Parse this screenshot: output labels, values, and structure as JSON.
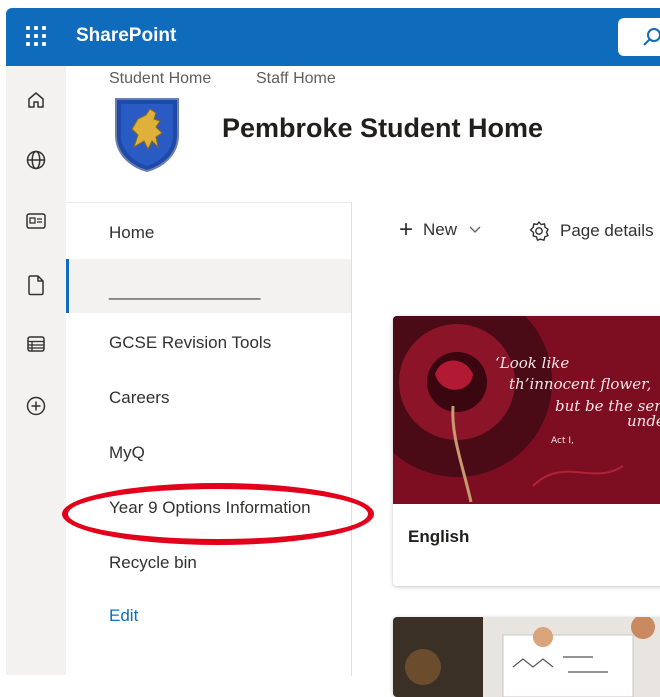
{
  "suite": {
    "app_name": "SharePoint",
    "waffle_icon": "waffle-icon",
    "search_icon": "search-icon",
    "brand_color": "#0f6cbd"
  },
  "rail": {
    "icons": [
      "home-icon",
      "globe-icon",
      "news-icon",
      "document-icon",
      "list-icon",
      "create-icon"
    ]
  },
  "site": {
    "top_nav": [
      "Student Home",
      "Staff Home"
    ],
    "title": "Pembroke Student Home",
    "logo": "school-crest-logo"
  },
  "left_nav": {
    "items": [
      "Home",
      "________________",
      "GCSE Revision Tools",
      "Careers",
      "MyQ",
      "Year 9 Options Information",
      "Recycle bin"
    ],
    "selected_index": 1,
    "edit_label": "Edit"
  },
  "command_bar": {
    "new_label": "New",
    "page_details_label": "Page details"
  },
  "cards": [
    {
      "title": "English",
      "image_quote": [
        "‘Look like",
        "th’innocent flower,",
        "but be the serpent",
        "under’t"
      ],
      "image_caption": "Act I,"
    },
    {
      "title": ""
    }
  ],
  "annotation": {
    "highlight_color": "#e3001b"
  }
}
